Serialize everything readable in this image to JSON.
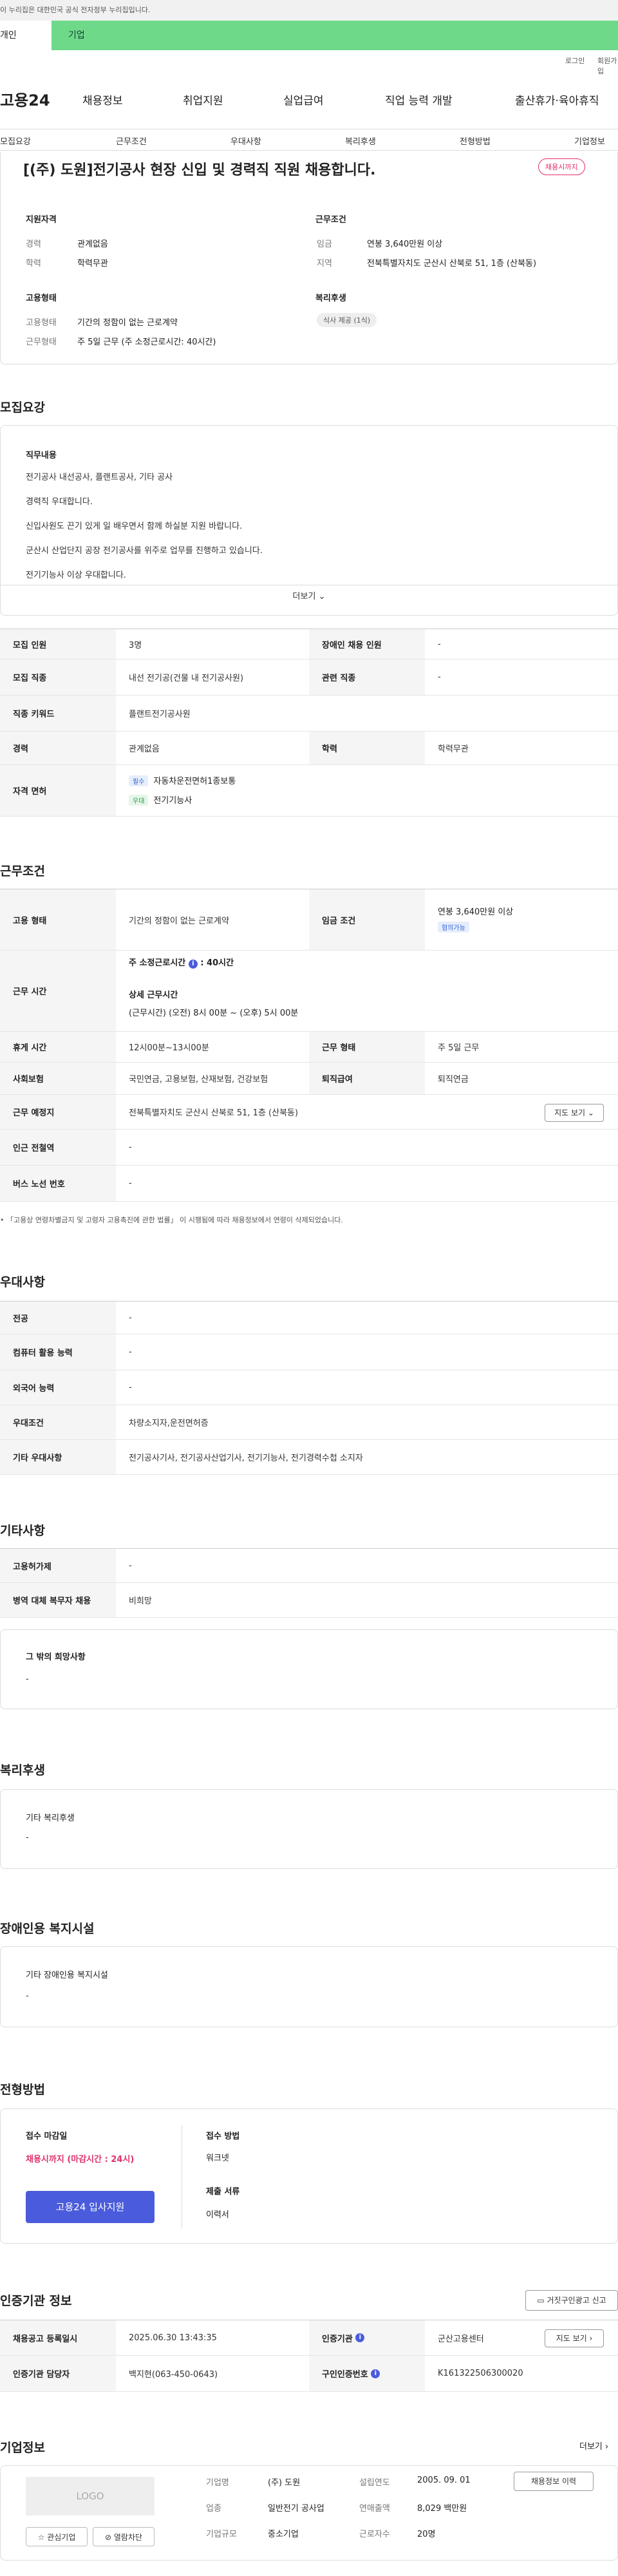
{
  "top": {
    "gov_notice": "이 누리집은 대한민국 공식 전자정부 누리집입니다.",
    "tab_personal": "개인",
    "tab_company": "기업",
    "login": "로그인",
    "join": "회원가입"
  },
  "gnb": {
    "logo": "고용24",
    "items": [
      "채용정보",
      "취업지원",
      "실업급여",
      "직업 능력 개발",
      "출산휴가·육아휴직"
    ]
  },
  "subnav": [
    "모집요강",
    "근무조건",
    "우대사항",
    "복리후생",
    "전형방법",
    "기업정보"
  ],
  "header": {
    "title": "[(주) 도원]전기공사 현장 신입 및 경력직 직원 채용합니다.",
    "badge": "채용시까지",
    "qual_label": "지원자격",
    "career_k": "경력",
    "career_v": "관계없음",
    "edu_k": "학력",
    "edu_v": "학력무관",
    "cond_label": "근무조건",
    "wage_k": "임금",
    "wage_v": "연봉 3,640만원 이상",
    "region_k": "지역",
    "region_v": "전북특별자치도 군산시 산북로 51, 1층 (산북동)",
    "emp_label": "고용형태",
    "emptype_k": "고용형태",
    "emptype_v": "기간의 정함이 없는 근로계약",
    "worktype_k": "근무형태",
    "worktype_v": "주 5일 근무 (주 소정근로시간: 40시간)",
    "welfare_label": "복리후생",
    "welfare_chip": "식사 제공 (1식)"
  },
  "recruit": {
    "heading": "모집요강",
    "duty_label": "직무내용",
    "lines": [
      "전기공사 내선공사, 플랜트공사, 기타 공사",
      "경력직 우대합니다.",
      "신입사원도 끈기 있게 일 배우면서 함께 하실분 지원 바랍니다.",
      "군산시 산업단지 공장 전기공사를 위주로 업무를 진행하고 있습니다.",
      "전기기능사 이상 우대합니다."
    ],
    "more": "더보기",
    "rows": {
      "count_k": "모집 인원",
      "count_v": "3명",
      "disabled_k": "장애인 채용 인원",
      "disabled_v": "-",
      "job_k": "모집 직종",
      "job_v": "내선 전기공(건물 내 전기공사원)",
      "related_k": "관련 직종",
      "related_v": "-",
      "keyword_k": "직종 키워드",
      "keyword_v": "플랜트전기공사원",
      "career_k": "경력",
      "career_v": "관계없음",
      "edu_k": "학력",
      "edu_v": "학력무관",
      "license_k": "자격 면허",
      "license_tag1": "필수",
      "license_1": "자동차운전면허1종보통",
      "license_tag2": "우대",
      "license_2": "전기기능사"
    }
  },
  "conditions": {
    "heading": "근무조건",
    "emptype_k": "고용 형태",
    "emptype_v": "기간의 정함이 없는 근로계약",
    "wage_k": "임금 조건",
    "wage_v": "연봉 3,640만원 이상",
    "wage_tag": "협의가능",
    "hours_k": "근무 시간",
    "hours_main": "주 소정근로시간",
    "hours_main_v": ": 40시간",
    "hours_sub": "상세 근무시간",
    "hours_sub_v": "(근무시간) (오전) 8시 00분 ~ (오후) 5시 00분",
    "rest_k": "휴게 시간",
    "rest_v": "12시00분~13시00분",
    "form_k": "근무 형태",
    "form_v": "주 5일 근무",
    "ins_k": "사회보험",
    "ins_v": "국민연금, 고용보험, 산재보험, 건강보험",
    "retire_k": "퇴직급여",
    "retire_v": "퇴직연금",
    "place_k": "근무 예정지",
    "place_v": "전북특별자치도 군산시 산북로 51, 1층 (산북동)",
    "map_btn": "지도 보기",
    "subway_k": "인근 전철역",
    "subway_v": "-",
    "bus_k": "버스 노선 번호",
    "bus_v": "-",
    "note": "「고용상 연령차별금지 및 고령자 고용촉진에 관한 법률」 이 시행됨에 따라 채용정보에서 연령이 삭제되었습니다."
  },
  "preference": {
    "heading": "우대사항",
    "major_k": "전공",
    "major_v": "-",
    "pc_k": "컴퓨터 활용 능력",
    "pc_v": "-",
    "lang_k": "외국어 능력",
    "lang_v": "-",
    "cond_k": "우대조건",
    "cond_v": "차량소지자,운전면허증",
    "etc_k": "기타 우대사항",
    "etc_v": "전기공사기사, 전기공사산업기사, 전기기능사, 전기경력수첩 소지자"
  },
  "etc": {
    "heading": "기타사항",
    "insure_k": "고용허가제",
    "insure_v": "-",
    "military_k": "병역 대체 복무자 채용",
    "military_v": "비희망",
    "wish_label": "그 밖의 희망사항",
    "wish_v": "-"
  },
  "welfare": {
    "heading": "복리후생",
    "label": "기타 복리후생",
    "value": "-"
  },
  "disability": {
    "heading": "장애인용 복지시설",
    "label": "기타 장애인용 복지시설",
    "value": "-"
  },
  "process": {
    "heading": "전형방법",
    "deadline_label": "접수 마감일",
    "deadline_v": "채용시까지 (마감시간 : 24시)",
    "apply_btn": "고용24 입사지원",
    "method_label": "접수 방법",
    "method_v": "워크넷",
    "docs_label": "제출 서류",
    "docs_v": "이력서"
  },
  "agency": {
    "heading": "인증기관 정보",
    "report_btn": "거짓구인광고 신고",
    "reg_k": "채용공고 등록일시",
    "reg_v": "2025.06.30 13:43:35",
    "agency_k": "인증기관",
    "agency_v": "군산고용센터",
    "map_btn": "지도 보기",
    "manager_k": "인증기관 담당자",
    "manager_v": "백지현(063-450-0643)",
    "auth_k": "구인인증번호",
    "auth_v": "K161322506300020"
  },
  "company": {
    "heading": "기업정보",
    "more": "더보기",
    "logo": "LOGO",
    "fav_btn": "관심기업",
    "block_btn": "열람차단",
    "name_k": "기업명",
    "name_v": "(주) 도원",
    "founded_k": "설립연도",
    "founded_v": "2005. 09. 01",
    "industry_k": "업종",
    "industry_v": "일반전기 공사업",
    "sales_k": "연매출액",
    "sales_v": "8,029 백만원",
    "size_k": "기업규모",
    "size_v": "중소기업",
    "staff_k": "근로자수",
    "staff_v": "20명",
    "jobs_btn": "채용정보 이력"
  }
}
